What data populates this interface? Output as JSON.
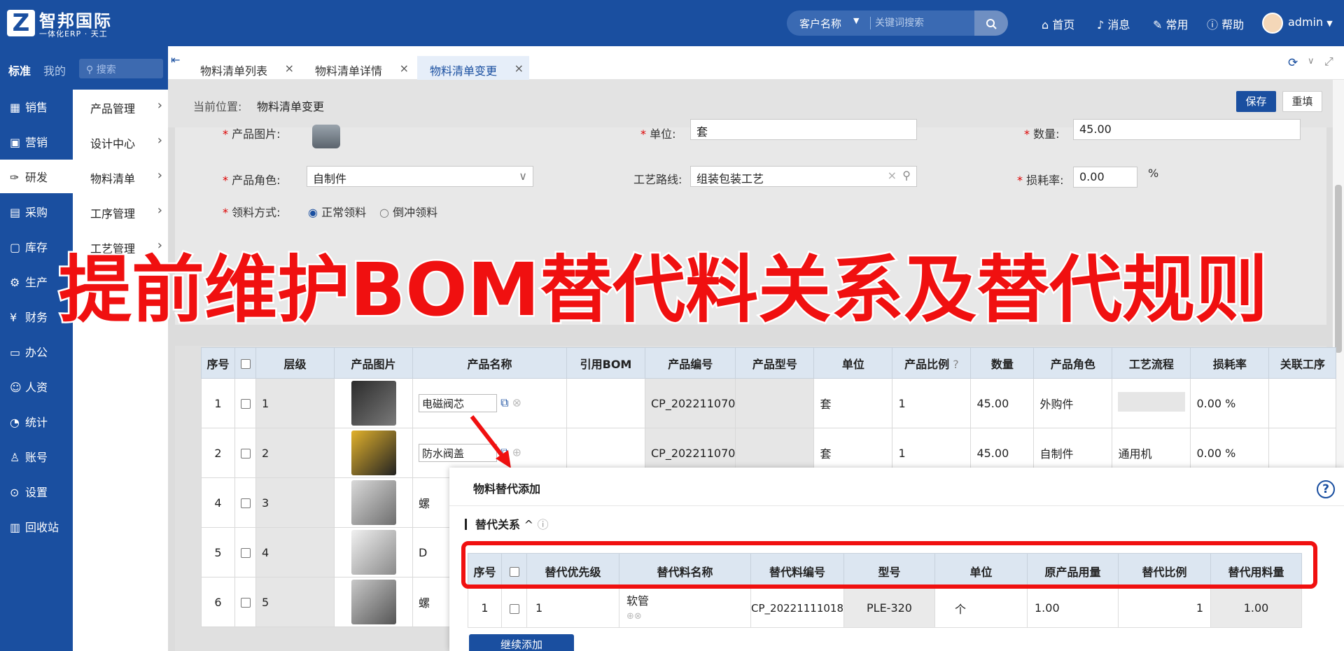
{
  "brand": {
    "logo_letter": "Z",
    "name": "智邦国际",
    "tagline": "一体化ERP · 天工"
  },
  "topbar": {
    "search_select": "客户名称",
    "search_placeholder": "关键词搜索",
    "nav": [
      {
        "label": "首页",
        "icon": "home-icon"
      },
      {
        "label": "消息",
        "icon": "bell-icon"
      },
      {
        "label": "常用",
        "icon": "wrench-icon"
      },
      {
        "label": "帮助",
        "icon": "help-icon"
      }
    ],
    "user": "admin"
  },
  "sidebar": {
    "tabs": [
      "标准",
      "我的"
    ],
    "search_placeholder": "搜索",
    "items": [
      {
        "label": "销售",
        "icon": "chart-icon"
      },
      {
        "label": "营销",
        "icon": "megaphone-icon"
      },
      {
        "label": "研发",
        "icon": "microscope-icon",
        "active": true
      },
      {
        "label": "采购",
        "icon": "basket-icon"
      },
      {
        "label": "库存",
        "icon": "warehouse-icon"
      },
      {
        "label": "生产",
        "icon": "factory-icon"
      },
      {
        "label": "财务",
        "icon": "yen-icon"
      },
      {
        "label": "办公",
        "icon": "briefcase-icon"
      },
      {
        "label": "人资",
        "icon": "people-icon"
      },
      {
        "label": "统计",
        "icon": "pie-icon"
      },
      {
        "label": "账号",
        "icon": "user-icon"
      },
      {
        "label": "设置",
        "icon": "settings-icon"
      },
      {
        "label": "回收站",
        "icon": "trash-icon"
      }
    ],
    "submenu": [
      "产品管理",
      "设计中心",
      "物料清单",
      "工序管理",
      "工艺管理"
    ]
  },
  "tabs": [
    {
      "label": "物料清单列表"
    },
    {
      "label": "物料清单详情"
    },
    {
      "label": "物料清单变更",
      "active": true
    }
  ],
  "location": {
    "label": "当前位置:",
    "value": "物料清单变更"
  },
  "actions": {
    "save": "保存",
    "reset": "重填"
  },
  "form": {
    "product_image_label": "产品图片:",
    "unit_label": "单位:",
    "unit_value": "套",
    "quantity_label": "数量:",
    "quantity_value": "45.00",
    "role_label": "产品角色:",
    "role_value": "自制件",
    "route_label": "工艺路线:",
    "route_value": "组装包装工艺",
    "loss_label": "损耗率:",
    "loss_value": "0.00",
    "loss_unit": "%",
    "pick_label": "领料方式:",
    "pick_options": [
      "正常领料",
      "倒冲领料"
    ],
    "pick_selected": "正常领料"
  },
  "overlay_title": "提前维护BOM替代料关系及替代规则",
  "bom_table": {
    "headers": [
      "序号",
      "",
      "层级",
      "产品图片",
      "产品名称",
      "引用BOM",
      "产品编号",
      "产品型号",
      "单位",
      "产品比例",
      "数量",
      "产品角色",
      "工艺流程",
      "损耗率",
      "关联工序"
    ],
    "rows": [
      {
        "seq": "1",
        "level": "1",
        "name": "电磁阀芯",
        "code": "CP_202211070",
        "unit": "套",
        "ratio": "1",
        "qty": "45.00",
        "role": "外购件",
        "process": "",
        "loss": "0.00",
        "pct": "%"
      },
      {
        "seq": "2",
        "level": "2",
        "name": "防水阀盖",
        "code": "CP_202211070",
        "unit": "套",
        "ratio": "1",
        "qty": "45.00",
        "role": "自制件",
        "process": "通用机",
        "loss": "0.00",
        "pct": "%"
      },
      {
        "seq": "4",
        "level": "3",
        "name": "螺",
        "code": "",
        "unit": "",
        "ratio": "",
        "qty": "",
        "role": "",
        "process": "",
        "loss": "",
        "pct": ""
      },
      {
        "seq": "5",
        "level": "4",
        "name": "D",
        "code": "",
        "unit": "",
        "ratio": "",
        "qty": "",
        "role": "",
        "process": "",
        "loss": "",
        "pct": ""
      },
      {
        "seq": "6",
        "level": "5",
        "name": "螺",
        "code": "",
        "unit": "",
        "ratio": "",
        "qty": "",
        "role": "",
        "process": "",
        "loss": "",
        "pct": ""
      }
    ]
  },
  "dialog": {
    "title": "物料替代添加",
    "section": "替代关系",
    "headers": [
      "序号",
      "",
      "替代优先级",
      "替代料名称",
      "替代料编号",
      "型号",
      "单位",
      "原产品用量",
      "替代比例",
      "替代用料量"
    ],
    "rows": [
      {
        "seq": "1",
        "priority": "1",
        "name": "软管",
        "code": "CP_20221111018",
        "model": "PLE-320",
        "unit": "个",
        "orig_qty": "1.00",
        "ratio": "1",
        "sub_qty": "1.00"
      }
    ],
    "more_button": "继续添加"
  },
  "colors": {
    "brand": "#1a4fa0",
    "highlight": "#f01010"
  }
}
